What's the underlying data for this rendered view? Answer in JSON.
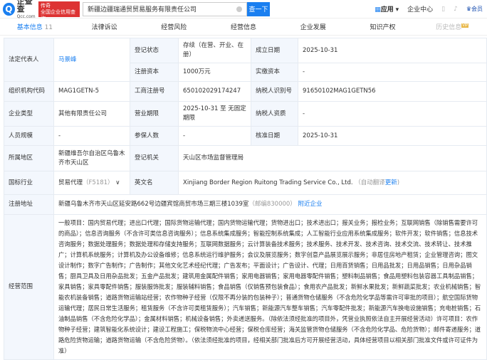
{
  "header": {
    "logo_text": "企查查",
    "logo_domain": "Qcc.com",
    "slogan_line1": "传奇",
    "slogan_line2": "全国企业信用查询",
    "search_value": "新疆边疆瑞通贸贸易服务有限责任公司",
    "search_button": "查一下",
    "apps": "应用",
    "enterprise_center": "企业中心",
    "member": "会员"
  },
  "tabs": [
    {
      "label": "基本信息",
      "count": "11"
    },
    {
      "label": "法律诉讼"
    },
    {
      "label": "经营风险"
    },
    {
      "label": "经营信息"
    },
    {
      "label": "企业发展"
    },
    {
      "label": "知识产权"
    },
    {
      "label": "历史信息",
      "badge": "VIP"
    }
  ],
  "info": {
    "legal_rep_label": "法定代表人",
    "legal_rep": "马景峰",
    "status_label": "登记状态",
    "status": "存续（在营、开业、在册）",
    "founded_label": "成立日期",
    "founded": "2025-10-31",
    "capital_label": "注册资本",
    "capital": "1000万元",
    "paid_label": "实缴资本",
    "paid": "-",
    "org_code_label": "组织机构代码",
    "org_code": "MAG1GETN-5",
    "reg_no_label": "工商注册号",
    "reg_no": "650102029174247",
    "tax_id_label": "纳税人识别号",
    "tax_id": "91650102MAG1GETN56",
    "type_label": "企业类型",
    "type": "其他有限责任公司",
    "term_label": "营业期限",
    "term": "2025-10-31 至 无固定期限",
    "tax_qual_label": "纳税人资质",
    "tax_qual": "-",
    "staff_label": "人员规模",
    "staff": "-",
    "insured_label": "参保人数",
    "insured": "-",
    "approved_label": "核准日期",
    "approved": "2025-10-31",
    "region_label": "所属地区",
    "region": "新疆维吾尔自治区乌鲁木齐市天山区",
    "authority_label": "登记机关",
    "authority": "天山区市场监督管理局",
    "industry_label": "国标行业",
    "industry": "贸易代理",
    "industry_code": "（F5181）",
    "en_name_label": "英文名",
    "en_name": "Xinjiang Border Region Ruitong Trading Service Co., Ltd.",
    "auto_translate": "（自动翻译",
    "update": "更新",
    "address_label": "注册地址",
    "address": "新疆乌鲁木齐市天山区延安路662号边疆宾馆商贸市场三期三楼1039室",
    "postcode": "（邮编830000）",
    "nearby": "附近企业",
    "scope_label": "经营范围",
    "scope": "一般项目：国内贸易代理；进出口代理；国际货物运输代理；国内货物运输代理；货物进出口；技术进出口；报关业务；报检业务；互联网销售（除销售需要许可的商品）；信息咨询服务（不含许可类信息咨询服务）；信息系统集成服务；智能控制系统集成；人工智能行业应用系统集成服务；软件开发；软件销售；信息技术咨询服务；数据处理服务；数据处理和存储支持服务；互联网数据服务；云计算装备技术服务；技术服务、技术开发、技术咨询、技术交流、技术转让、技术推广；计算机系统服务；计算机及办公设备维修；信息系统运行维护服务；会议及展览服务；数字创意产品展览展示服务；非居住房地产租赁；企业管理咨询；图文设计制作；数字广告制作；广告制作；其他文化艺术经纪代理；广告发布；平面设计；广告设计、代理；日用百货销售；日用品批发；日用品销售；日用杂品销售；厨具卫具及日用杂品批发；五金产品批发；建筑用金属配件销售；家用电器销售；家用电器零配件销售；塑料制品销售；食品用塑料包装容器工具制品销售；家具销售；家具零配件销售；服装服饰批发；服装辅料销售；食品销售（仅销售预包装食品）；食用农产品批发；新鲜水果批发；新鲜蔬菜批发；农业机械销售；智能农机装备销售；道路货物运输站经营；农作物种子经营（仅限不再分装的包装种子）；普通货物仓储服务（不含危险化学品等需许可审批的项目）；航空国际货物运输代理；居民日常生活服务；租赁服务（不含许可类租赁服务）；汽车销售；新能源汽车整车销售；汽车零配件批发；新能源汽车换电设施销售；充电桩销售；石油制品销售（不含危险化学品）；金属材料销售；机械设备销售；外卖递送服务。（除依法须经批准的项目外，凭营业执照依法自主开展经营活动）许可项目：农作物种子经营；建筑智能化系统设计；建设工程施工；保税物流中心经营；保税仓库经营；海关监管货物仓储服务（不含危险化学品、危险货物）；邮件寄递服务；道路危险货物运输；道路货物运输（不含危险货物）。（依法须经批准的项目，经相关部门批准后方可开展经营活动，具体经营项目以相关部门批准文件或许可证件为准）"
  }
}
